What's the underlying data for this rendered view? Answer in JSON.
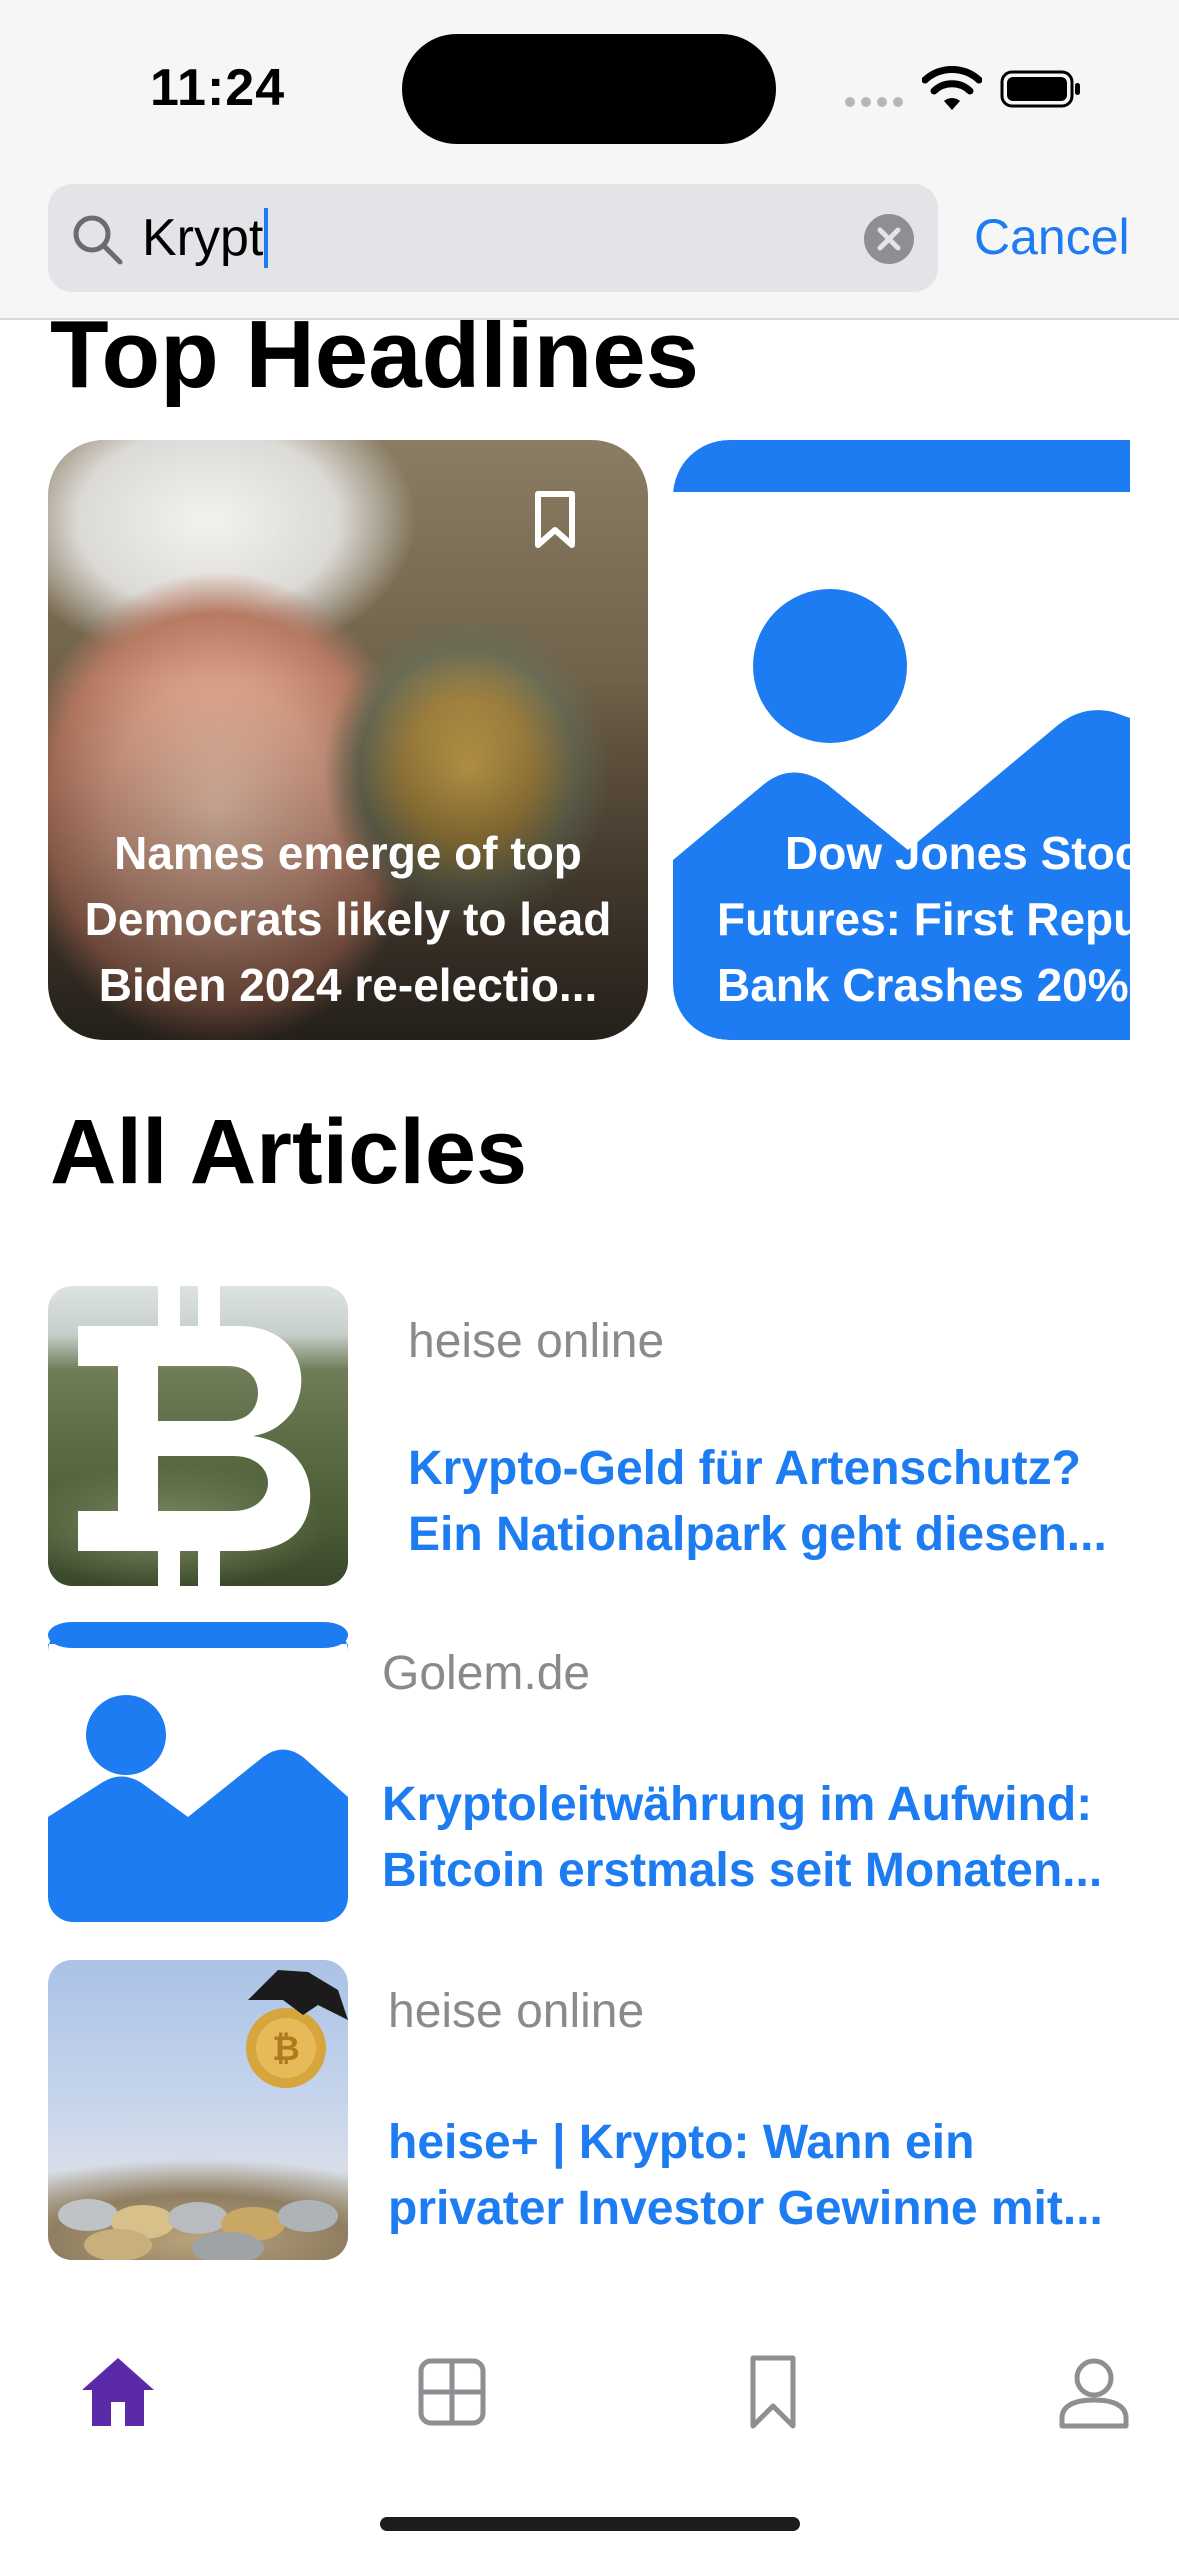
{
  "status_bar": {
    "time": "11:24"
  },
  "search": {
    "query": "Krypt",
    "cancel_label": "Cancel"
  },
  "top_headlines": {
    "title": "Top Headlines",
    "cards": [
      {
        "title_lines": [
          "Names emerge of top",
          "Democrats likely to lead",
          "Biden 2024 re-electio..."
        ]
      },
      {
        "title_lines": [
          "Dow Jones Stoc",
          "Futures: First Repu",
          "Bank Crashes 20%"
        ]
      }
    ]
  },
  "all_articles": {
    "title": "All Articles",
    "items": [
      {
        "source": "heise online",
        "title_lines": [
          "Krypto-Geld für Artenschutz?",
          "Ein Nationalpark geht diesen..."
        ]
      },
      {
        "source": "Golem.de",
        "title_lines": [
          "Kryptoleitwährung im Aufwind:",
          "Bitcoin erstmals seit Monaten..."
        ]
      },
      {
        "source": "heise online",
        "title_lines": [
          "heise+ | Krypto: Wann ein",
          "privater Investor Gewinne mit..."
        ]
      }
    ]
  },
  "tab_bar": {
    "tabs": [
      "home-icon",
      "grid-icon",
      "bookmark-icon",
      "person-icon"
    ],
    "selected": 0
  },
  "colors": {
    "accent": "#1d7cf2",
    "tab_selected": "#5b2aa8",
    "tab_inactive": "#8e8e93"
  }
}
